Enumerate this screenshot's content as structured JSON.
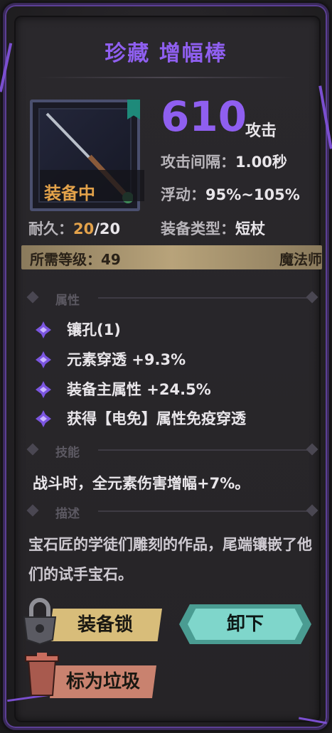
{
  "item": {
    "title": "珍藏 增幅棒",
    "equipped_label": "装备中",
    "attack_value": "610",
    "attack_label": "攻击",
    "interval_label": "攻击间隔：",
    "interval_value": "1.00秒",
    "float_label": "浮动：",
    "float_value": "95%~105%",
    "durability_label": "耐久：",
    "durability_current": "20",
    "durability_sep": "/",
    "durability_max": "20",
    "type_label": "装备类型：",
    "type_value": "短杖",
    "req_label": "所需等级：",
    "req_value": "49",
    "class": "魔法师"
  },
  "sections": {
    "attributes": "属性",
    "skills": "技能",
    "description": "描述"
  },
  "attributes": [
    "镶孔(1)",
    "元素穿透 +9.3%",
    "装备主属性 +24.5%",
    "获得【电免】属性免疫穿透"
  ],
  "skill_text": "战斗时，全元素伤害增幅+7%。",
  "description_text": "宝石匠的学徒们雕刻的作品，尾端镶嵌了他们的试手宝石。",
  "buttons": {
    "lock": "装备锁",
    "unequip": "卸下",
    "junk": "标为垃圾"
  },
  "icons": {
    "lock": "padlock-icon",
    "junk": "trash-can-icon",
    "attr_bullet": "sparkle-icon",
    "weapon": "wand-icon",
    "gem": "gem-icon"
  },
  "colors": {
    "title": "#8f5ff0",
    "equipped": "#e3a24a",
    "lock_button": "#d8bd7a",
    "unequip_button": "#7fd6cb",
    "junk_button": "#c9826f"
  }
}
